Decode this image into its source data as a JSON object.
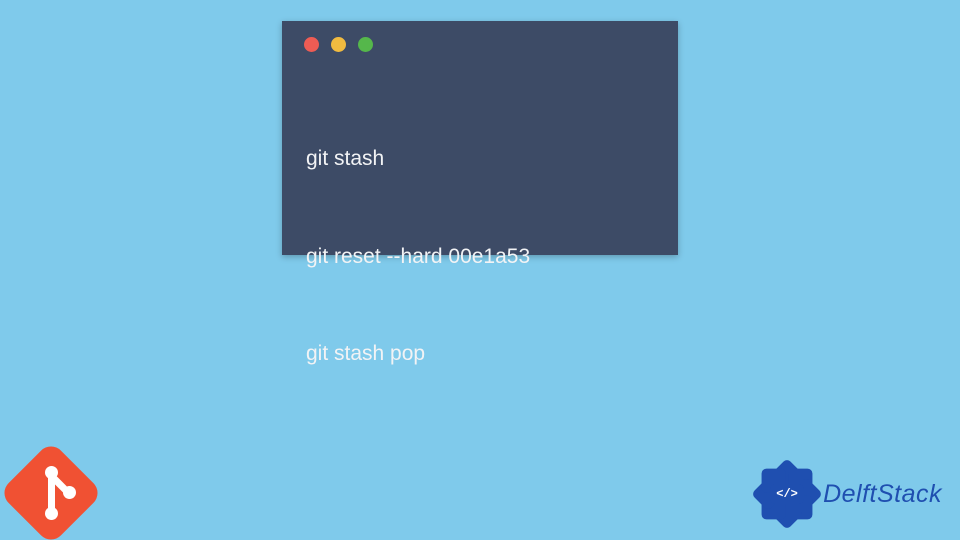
{
  "terminal": {
    "traffic_lights": {
      "red": "#ee5c54",
      "yellow": "#f1bb40",
      "green": "#55b74b"
    },
    "lines": [
      "git stash",
      "git reset --hard 00e1a53",
      "git stash pop"
    ]
  },
  "branding": {
    "git_icon": "git-icon",
    "delft_badge_glyph": "</>",
    "delft_label": "DelftStack"
  },
  "colors": {
    "page_bg": "#7fcaeb",
    "terminal_bg": "#3d4b66",
    "terminal_fg": "#f2f3f5",
    "git_orange": "#f05133",
    "delft_blue": "#1f4fb0"
  }
}
